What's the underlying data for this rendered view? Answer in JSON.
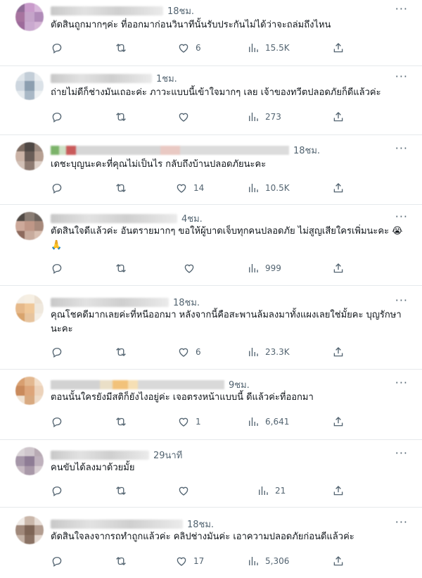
{
  "replies": [
    {
      "time": "18ชม.",
      "text": "ตัดสินถูกมากๆค่ะ ที่ออกมาก่อนวินาทีนั้นรับประกันไม่ได้ว่าจะถล่มถึงไหน",
      "counts": {
        "replies": "",
        "reposts": "",
        "likes": "6",
        "views": "15.5K"
      }
    },
    {
      "time": "1ชม.",
      "text": "ถ่ายไม่ดีก็ช่างมันเถอะค่ะ ภาวะแบบนี้เข้าใจมากๆ เลย เจ้าของทวีตปลอดภัยก็ดีแล้วค่ะ",
      "counts": {
        "replies": "",
        "reposts": "",
        "likes": "",
        "views": "273"
      }
    },
    {
      "time": "18ชม.",
      "text": "เดชะบุญนะคะที่คุณไม่เป็นไร กลับถึงบ้านปลอดภัยนะคะ",
      "counts": {
        "replies": "",
        "reposts": "",
        "likes": "14",
        "views": "10.5K"
      }
    },
    {
      "time": "4ชม.",
      "text": "ตัดสินใจดีแล้วค่ะ อันตรายมากๆ ขอให้ผู้บาดเจ็บทุกคนปลอดภัย ไม่สูญเสียใครเพิ่มนะคะ 😭🙏",
      "counts": {
        "replies": "",
        "reposts": "",
        "likes": "",
        "views": "999"
      }
    },
    {
      "time": "18ชม.",
      "text": "คุณโชคดีมากเลยค่ะที่หนีออกมา หลังจากนี้คือสะพานล้มลงมาทั้งแผงเลยใช่มั้ยคะ บุญรักษานะคะ",
      "counts": {
        "replies": "",
        "reposts": "",
        "likes": "6",
        "views": "23.3K"
      }
    },
    {
      "time": "9ชม.",
      "text": "ตอนนั้นใครยังมีสติก็ยังไงอยู่ค่ะ เจอตรงหน้าแบบนี้ ดีแล้วค่ะที่ออกมา",
      "counts": {
        "replies": "",
        "reposts": "",
        "likes": "1",
        "views": "6,641"
      }
    },
    {
      "time": "29นาที",
      "text": "คนขับได้ลงมาด้วยมั้ย",
      "counts": {
        "replies": "",
        "reposts": "",
        "likes": "",
        "views": "21"
      }
    },
    {
      "time": "18ชม.",
      "text": "ตัดสินใจลงจากรถทำถูกแล้วค่ะ คลิปช่างมันค่ะ เอาความปลอดภัยก่อนดีแล้วค่ะ",
      "counts": {
        "replies": "",
        "reposts": "",
        "likes": "17",
        "views": "5,306"
      }
    }
  ],
  "more_glyph": "···",
  "colors": {
    "text": "#0f1419",
    "muted": "#536471",
    "divider": "#e6e9ec"
  },
  "icons": [
    "reply-icon",
    "repost-icon",
    "like-icon",
    "views-icon",
    "share-icon"
  ]
}
